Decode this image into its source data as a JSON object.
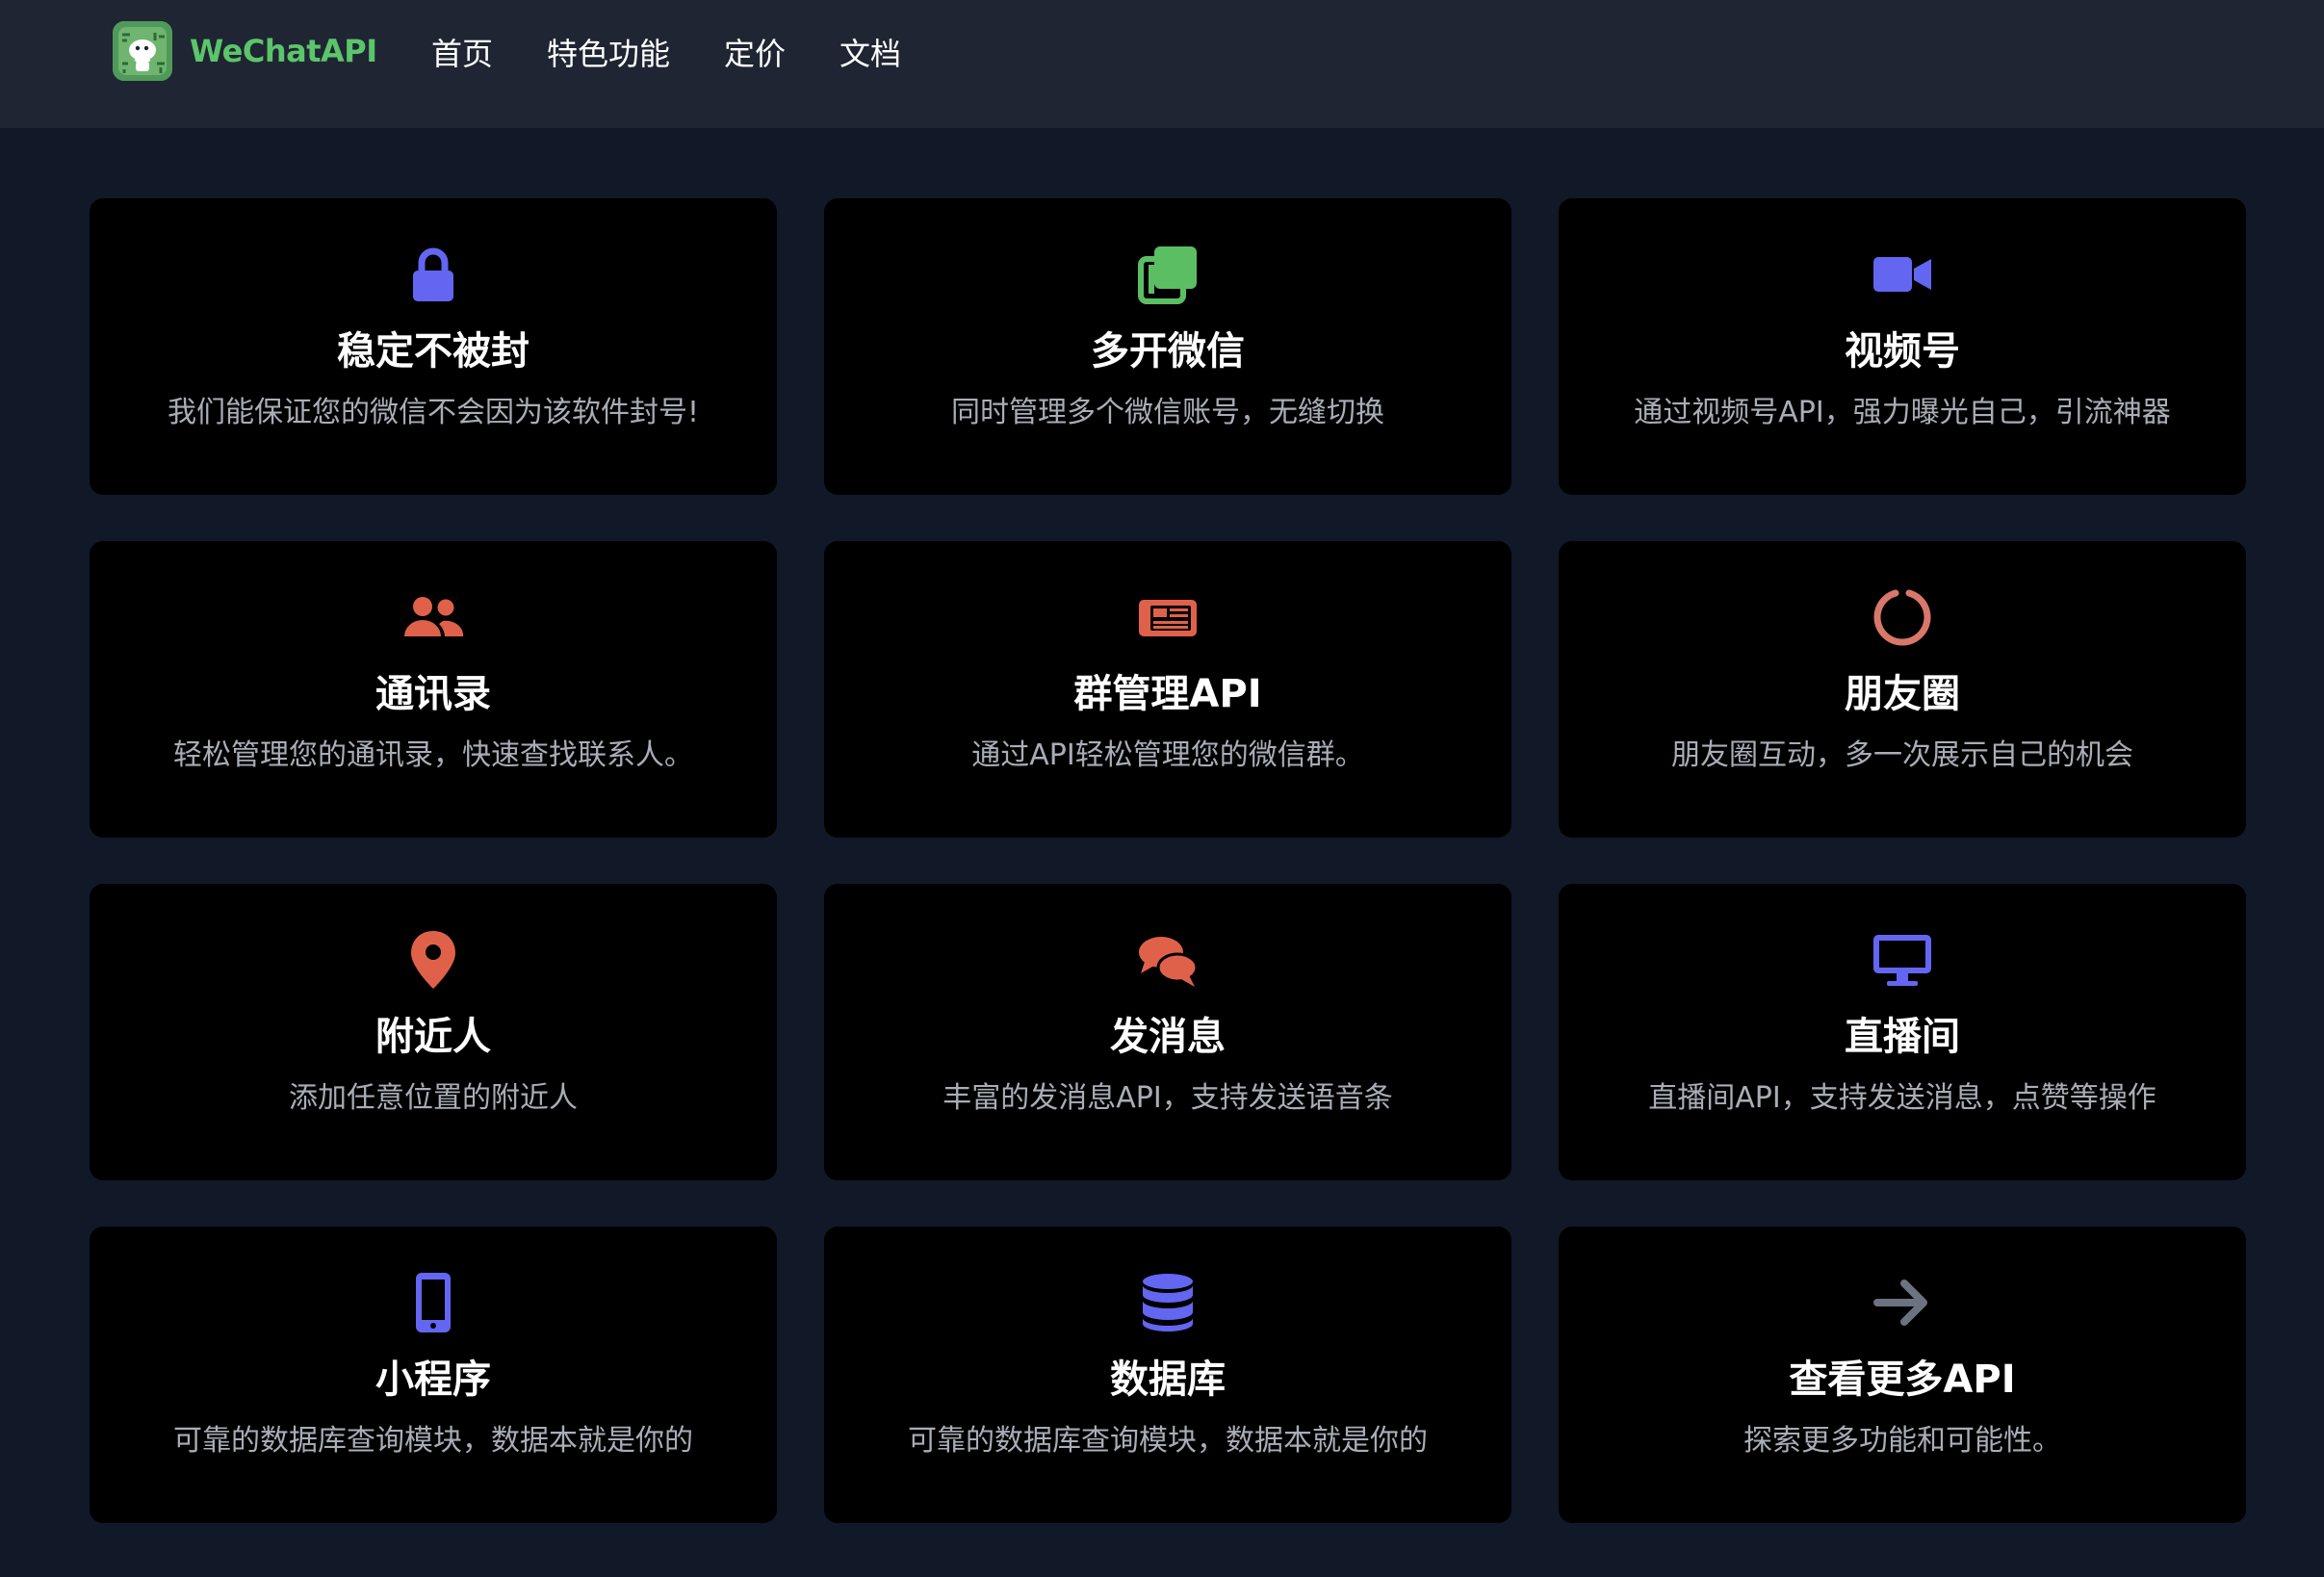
{
  "header": {
    "brand": "WeChatAPI",
    "nav": [
      "首页",
      "特色功能",
      "定价",
      "文档"
    ]
  },
  "colors": {
    "navbar_bg": "#1f2532",
    "page_bg": "#111827",
    "card_bg": "#000000",
    "brand_green": "#5cc46a",
    "indigo": "#6366f1",
    "green": "#5cbe62",
    "coral": "#e0614a",
    "salmon": "#d9776a",
    "gray": "#6b7280"
  },
  "features": [
    {
      "icon": "lock-icon",
      "color": "#6366f1",
      "title": "稳定不被封",
      "desc": "我们能保证您的微信不会因为该软件封号!"
    },
    {
      "icon": "copy-icon",
      "color": "#5cbe62",
      "title": "多开微信",
      "desc": "同时管理多个微信账号，无缝切换"
    },
    {
      "icon": "video-icon",
      "color": "#6366f1",
      "title": "视频号",
      "desc": "通过视频号API，强力曝光自己，引流神器"
    },
    {
      "icon": "users-icon",
      "color": "#e0614a",
      "title": "通讯录",
      "desc": "轻松管理您的通讯录，快速查找联系人。"
    },
    {
      "icon": "newspaper-icon",
      "color": "#e0614a",
      "title": "群管理API",
      "desc": "通过API轻松管理您的微信群。"
    },
    {
      "icon": "circle-notch-icon",
      "color": "#d9776a",
      "title": "朋友圈",
      "desc": "朋友圈互动，多一次展示自己的机会"
    },
    {
      "icon": "map-pin-icon",
      "color": "#e0614a",
      "title": "附近人",
      "desc": "添加任意位置的附近人"
    },
    {
      "icon": "chat-bubbles-icon",
      "color": "#e0614a",
      "title": "发消息",
      "desc": "丰富的发消息API，支持发送语音条"
    },
    {
      "icon": "monitor-icon",
      "color": "#6366f1",
      "title": "直播间",
      "desc": "直播间API，支持发送消息，点赞等操作"
    },
    {
      "icon": "mobile-icon",
      "color": "#6366f1",
      "title": "小程序",
      "desc": "可靠的数据库查询模块，数据本就是你的"
    },
    {
      "icon": "database-icon",
      "color": "#6366f1",
      "title": "数据库",
      "desc": "可靠的数据库查询模块，数据本就是你的"
    },
    {
      "icon": "arrow-right-icon",
      "color": "#6b7280",
      "title": "查看更多API",
      "desc": "探索更多功能和可能性。"
    }
  ]
}
